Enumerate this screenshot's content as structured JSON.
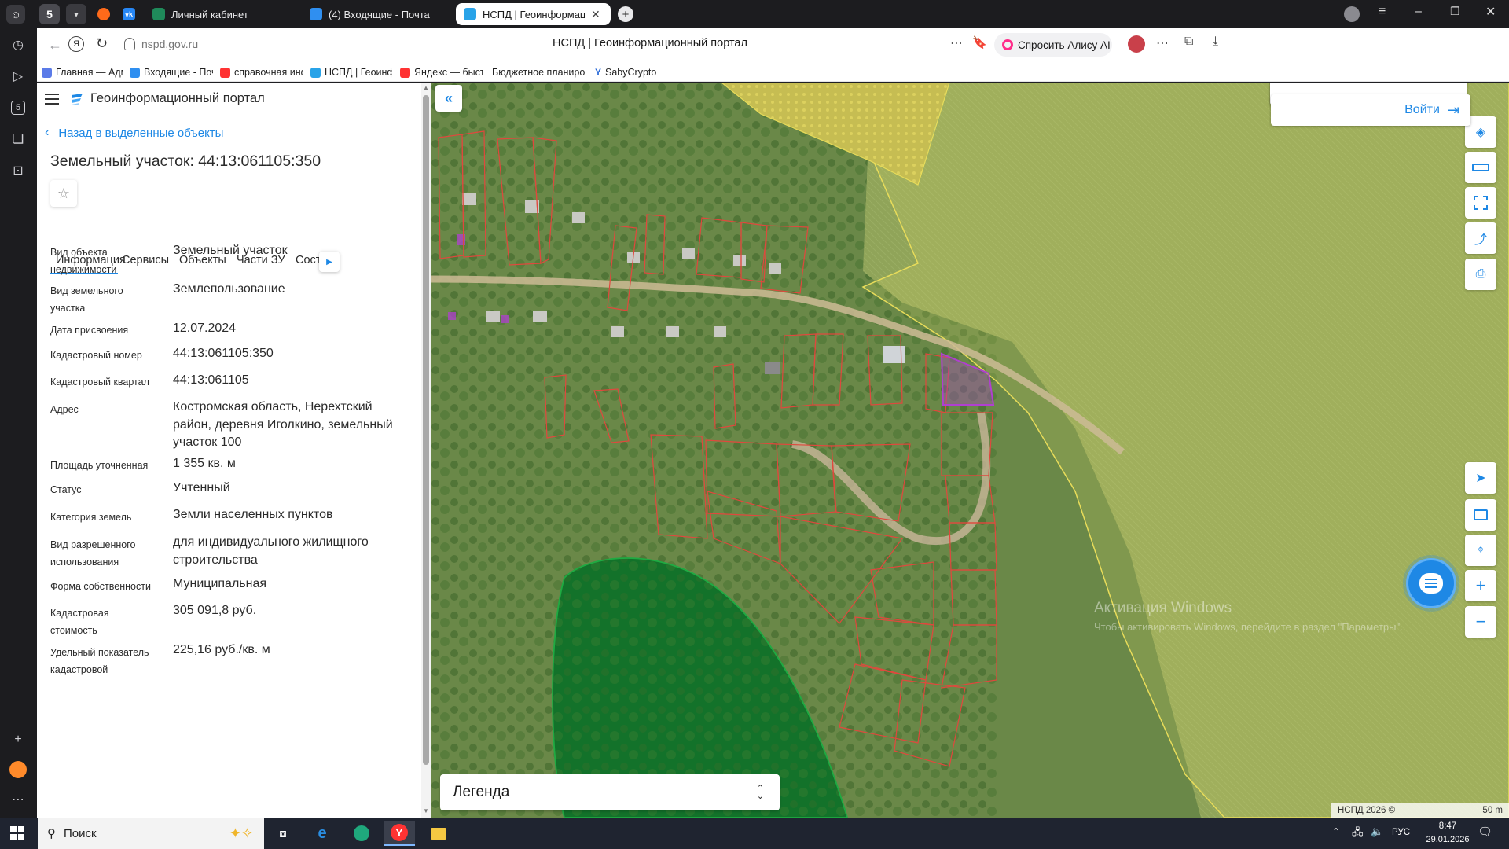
{
  "browser": {
    "tabs": [
      {
        "label": "Личный кабинет"
      },
      {
        "label": "(4) Входящие - Почта"
      },
      {
        "label": "НСПД | Геоинформационный портал"
      }
    ],
    "address": {
      "url": "nspd.gov.ru",
      "page_title": "НСПД | Геоинформационный портал",
      "alice_button": "Спросить Алису AI"
    },
    "bookmarks": [
      {
        "label": "Главная — Админ"
      },
      {
        "label": "Входящие - Почта"
      },
      {
        "label": "справочная инфо"
      },
      {
        "label": "НСПД | Геоинфор"
      },
      {
        "label": "Яндекс — быстры"
      },
      {
        "label": "Бюджетное планиро"
      },
      {
        "label": "SabyCrypto"
      }
    ]
  },
  "panel": {
    "header_title": "Геоинформационный портал",
    "back_link": "Назад в выделенные объекты",
    "object_title": "Земельный участок: 44:13:061105:350",
    "tabs": [
      "Информация",
      "Сервисы",
      "Объекты",
      "Части ЗУ",
      "Соста"
    ],
    "properties": [
      {
        "label": "Вид объекта недвижимости",
        "value": "Земельный участок"
      },
      {
        "label": "Вид земельного участка",
        "value": "Землепользование"
      },
      {
        "label": "Дата присвоения",
        "value": "12.07.2024"
      },
      {
        "label": "Кадастровый номер",
        "value": "44:13:061105:350"
      },
      {
        "label": "Кадастровый квартал",
        "value": "44:13:061105"
      },
      {
        "label": "Адрес",
        "value": "Костромская область, Нерехтский район, деревня Иголкино, земельный участок 100"
      },
      {
        "label": "Площадь уточненная",
        "value": "1 355 кв. м"
      },
      {
        "label": "Статус",
        "value": "Учтенный"
      },
      {
        "label": "Категория земель",
        "value": "Земли населенных пунктов"
      },
      {
        "label": "Вид разрешенного использования",
        "value": "для индивидуального жилищного строительства"
      },
      {
        "label": "Форма собственности",
        "value": "Муниципальная"
      },
      {
        "label": "Кадастровая стоимость",
        "value": "305 091,8 руб."
      },
      {
        "label": "Удельный показатель кадастровой",
        "value": "225,16 руб./кв. м"
      }
    ]
  },
  "map": {
    "login_button": "Войти",
    "legend_label": "Легенда",
    "watermark_title": "Активация Windows",
    "watermark_sub": "Чтобы активировать Windows, перейдите в раздел \"Параметры\".",
    "copyright": "НСПД 2026 ©",
    "scale": "50 m"
  },
  "taskbar": {
    "search_label": "Поиск",
    "language": "РУС",
    "time": "8:47",
    "date": "29.01.2026"
  },
  "colors": {
    "accent": "#1e88e5",
    "parcel_outline": "#e0483d",
    "selected_parcel": "#b03fd0",
    "forest_zone": "#1faa42",
    "farmland_zone": "#f0e36a"
  }
}
